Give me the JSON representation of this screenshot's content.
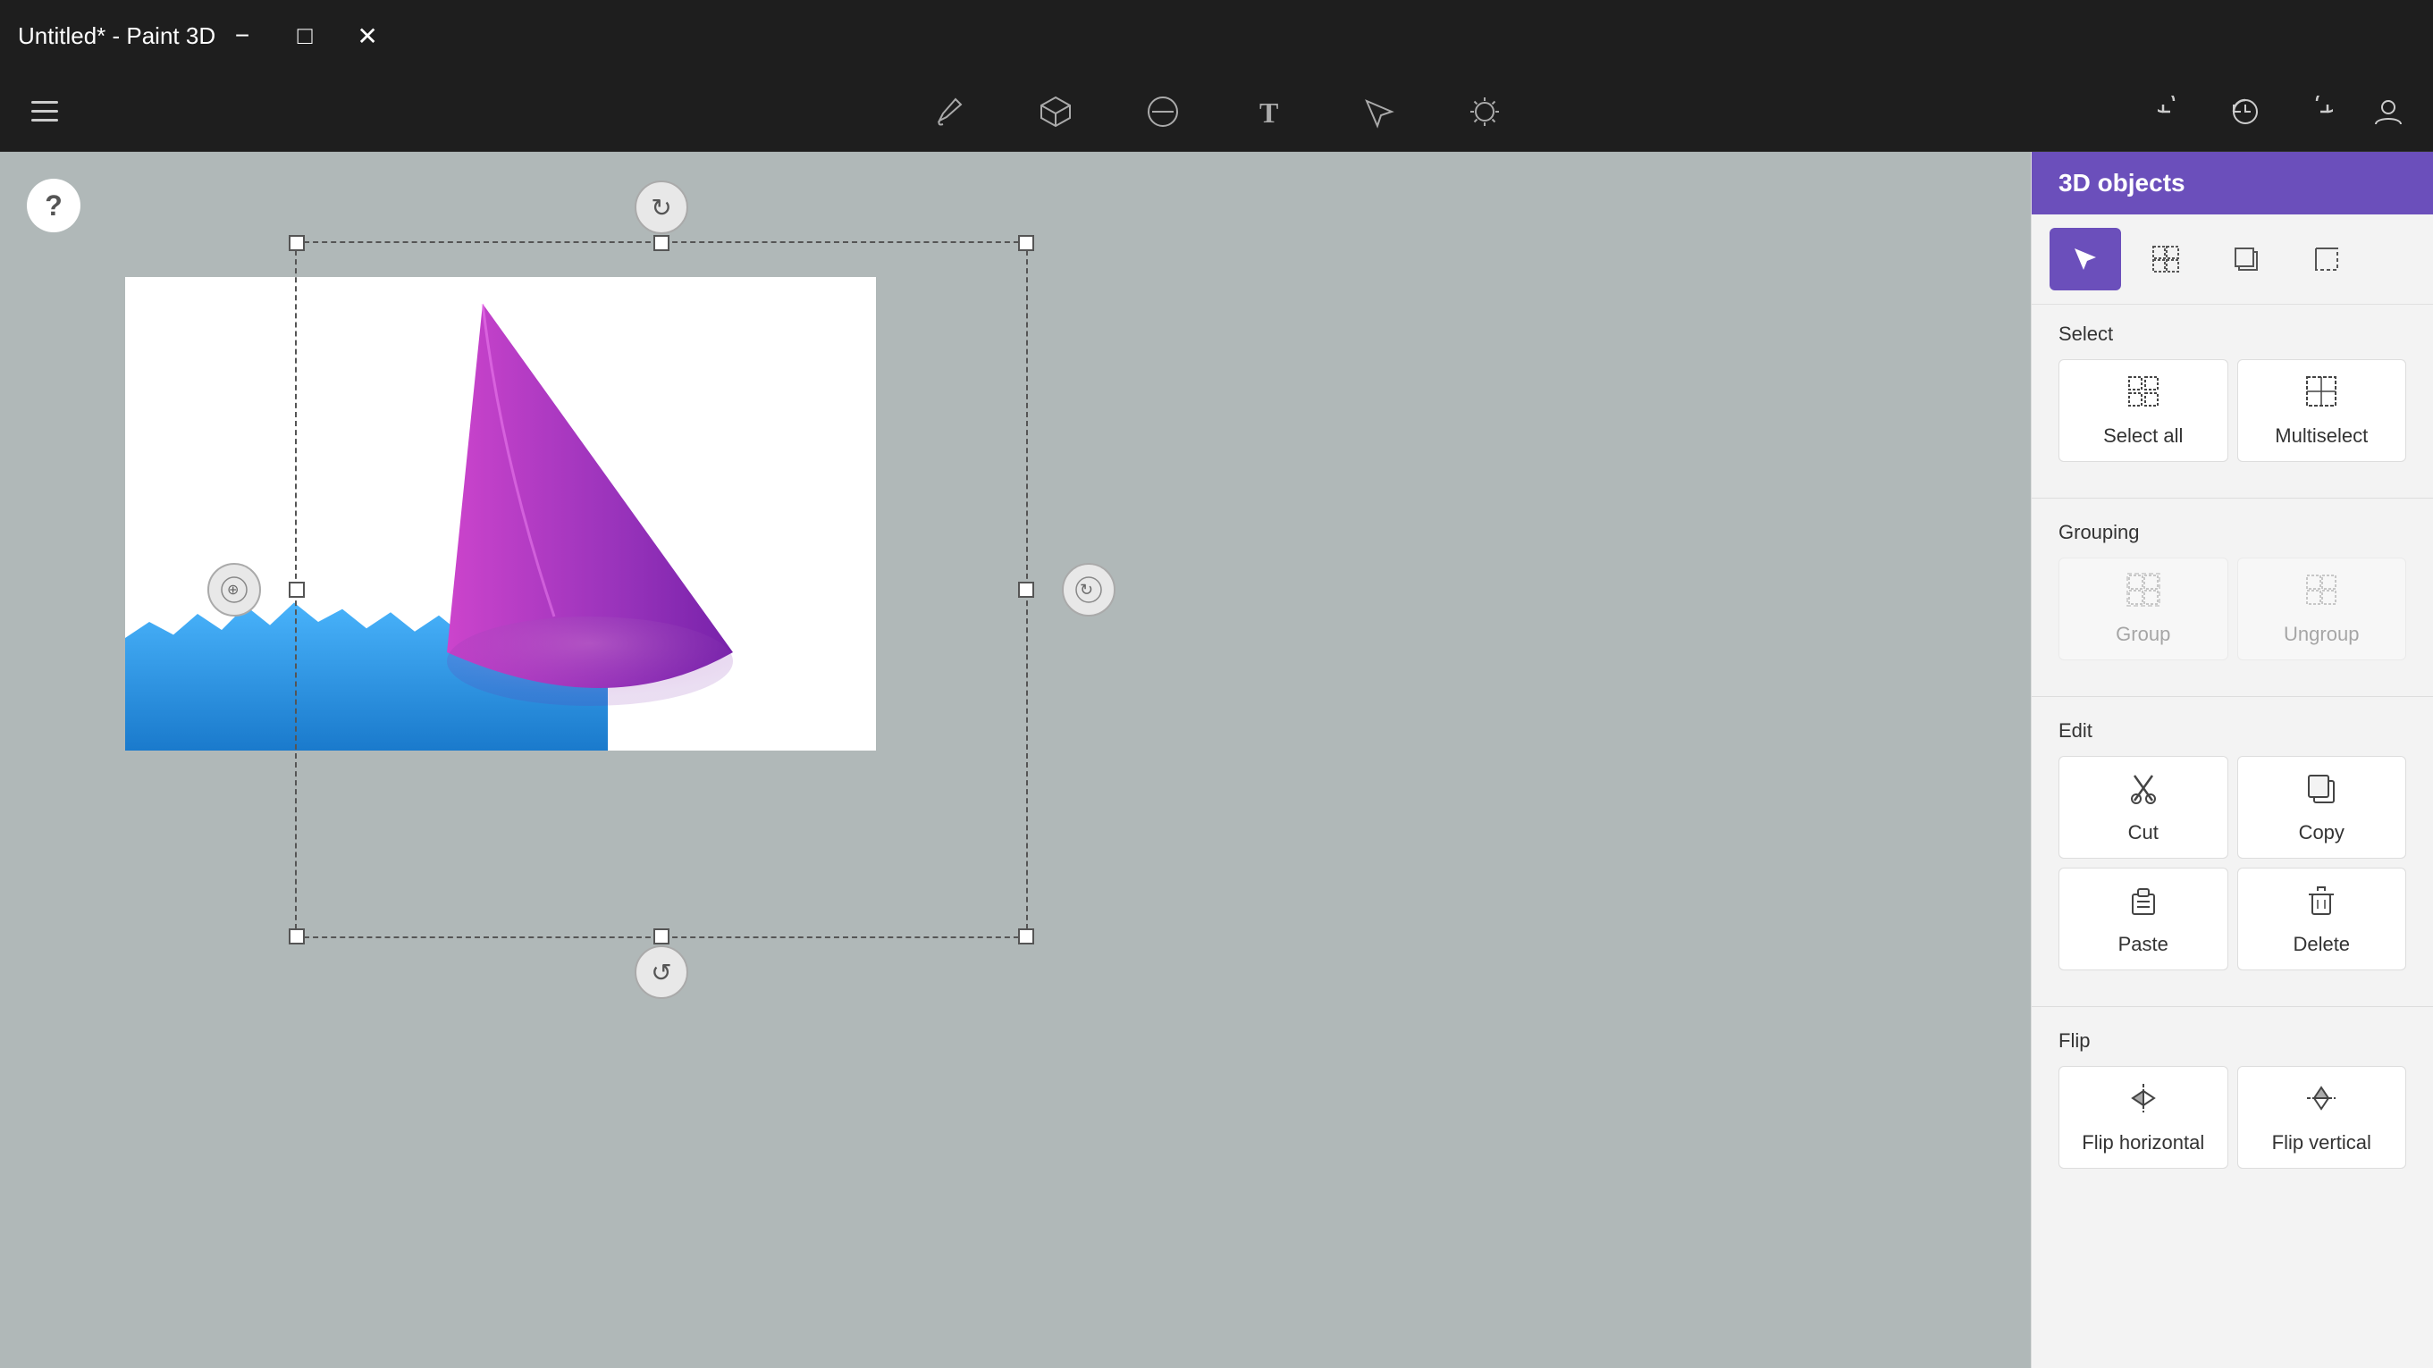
{
  "titlebar": {
    "title": "Untitled* - Paint 3D",
    "minimize_label": "−",
    "maximize_label": "□",
    "close_label": "✕"
  },
  "toolbar": {
    "hamburger_label": "Menu",
    "tools": [
      {
        "id": "brush",
        "label": "Brushes",
        "icon": "✏️"
      },
      {
        "id": "3d",
        "label": "3D shapes",
        "icon": "⬡"
      },
      {
        "id": "eraser",
        "label": "Eraser",
        "icon": "⊘"
      },
      {
        "id": "text",
        "label": "Text",
        "icon": "T"
      },
      {
        "id": "select",
        "label": "Select",
        "icon": "⤢"
      },
      {
        "id": "effects",
        "label": "Effects",
        "icon": "✦"
      }
    ],
    "undo_label": "Undo",
    "history_label": "History",
    "redo_label": "Redo",
    "account_label": "Account"
  },
  "canvas": {
    "help_label": "?",
    "rotate_top_icon": "↻",
    "rotate_bottom_icon": "↺",
    "move_left_icon": "⊕",
    "move_right_icon": "⊙"
  },
  "panel": {
    "title": "3D objects",
    "tools": [
      {
        "id": "select",
        "label": "Select",
        "icon": "↖",
        "active": true
      },
      {
        "id": "multiselect",
        "label": "Multiselect",
        "icon": "⊞"
      },
      {
        "id": "duplicate",
        "label": "Duplicate",
        "icon": "❐"
      },
      {
        "id": "crop",
        "label": "Crop",
        "icon": "⊡"
      }
    ],
    "sections": {
      "select": {
        "title": "Select",
        "buttons": [
          {
            "id": "select-all",
            "label": "Select all",
            "icon": "⊞",
            "disabled": false
          },
          {
            "id": "multiselect",
            "label": "Multiselect",
            "icon": "⊟",
            "disabled": false
          }
        ]
      },
      "grouping": {
        "title": "Grouping",
        "buttons": [
          {
            "id": "group",
            "label": "Group",
            "icon": "⊞",
            "disabled": true
          },
          {
            "id": "ungroup",
            "label": "Ungroup",
            "icon": "⊟",
            "disabled": true
          }
        ]
      },
      "edit": {
        "title": "Edit",
        "buttons": [
          {
            "id": "cut",
            "label": "Cut",
            "icon": "✂",
            "disabled": false
          },
          {
            "id": "copy",
            "label": "Copy",
            "icon": "❐",
            "disabled": false
          },
          {
            "id": "paste",
            "label": "Paste",
            "icon": "📋",
            "disabled": false
          },
          {
            "id": "delete",
            "label": "Delete",
            "icon": "🗑",
            "disabled": false
          }
        ]
      },
      "flip": {
        "title": "Flip",
        "buttons": [
          {
            "id": "flip-horizontal",
            "label": "Flip horizontal",
            "icon": "⇔",
            "disabled": false
          },
          {
            "id": "flip-vertical",
            "label": "Flip vertical",
            "icon": "⇕",
            "disabled": false
          }
        ]
      }
    }
  }
}
